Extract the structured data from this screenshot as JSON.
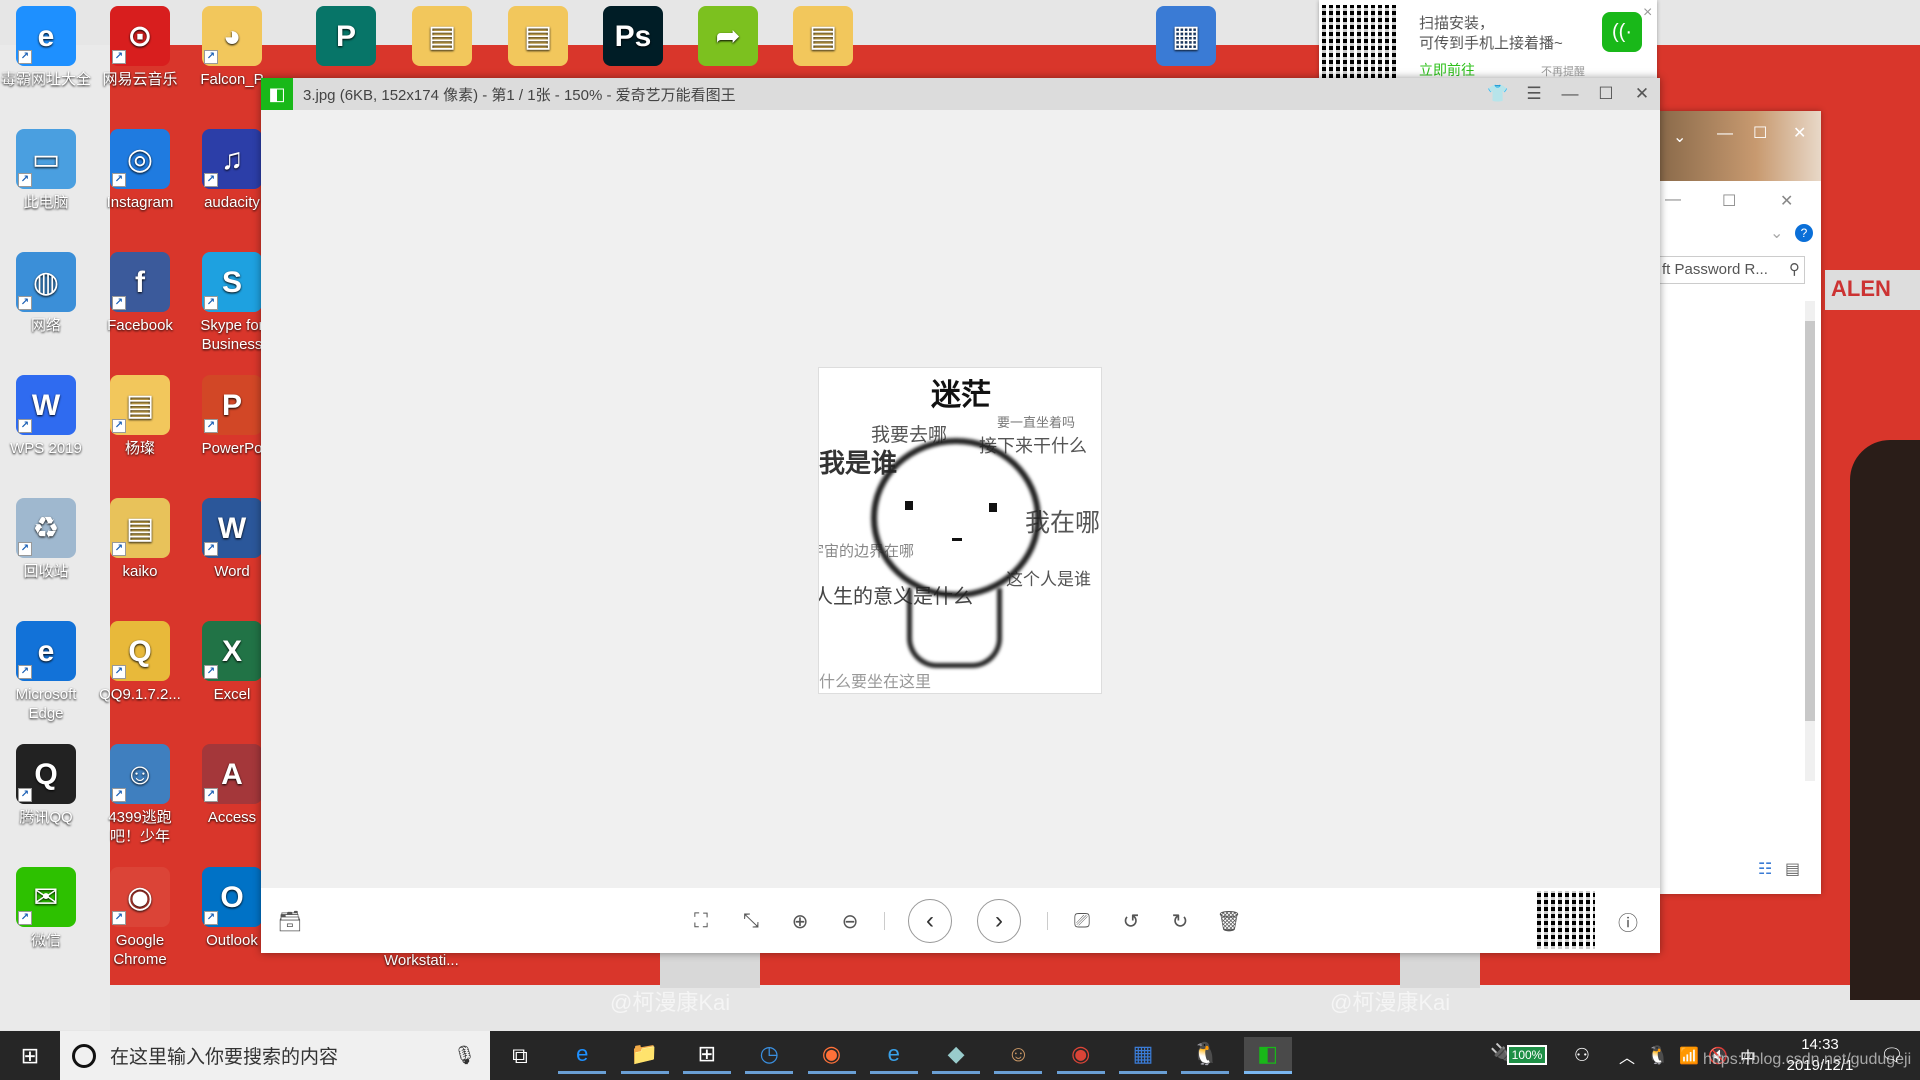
{
  "desktop": {
    "icons": [
      {
        "label": "毒霸网址大全",
        "glyph": "e",
        "color": "#1e90ff"
      },
      {
        "label": "网易云音乐",
        "glyph": "⊙",
        "color": "#d81e1e"
      },
      {
        "label": "Falcon_P",
        "glyph": "◕",
        "color": "#f2c75c"
      },
      {
        "label": "此电脑",
        "glyph": "▭",
        "color": "#4a9fe0"
      },
      {
        "label": "Instagram",
        "glyph": "◎",
        "color": "#1f7be0"
      },
      {
        "label": "audacity",
        "glyph": "♫",
        "color": "#2c3ea8"
      },
      {
        "label": "网络",
        "glyph": "◍",
        "color": "#3b8fd8"
      },
      {
        "label": "Facebook",
        "glyph": "f",
        "color": "#3b5a9b"
      },
      {
        "label": "Skype for Business",
        "glyph": "S",
        "color": "#1ea1e0"
      },
      {
        "label": "WPS 2019",
        "glyph": "W",
        "color": "#2f6bf0"
      },
      {
        "label": "杨璨",
        "glyph": "▤",
        "color": "#f2c75c"
      },
      {
        "label": "PowerPo",
        "glyph": "P",
        "color": "#d24726"
      },
      {
        "label": "回收站",
        "glyph": "♻",
        "color": "#9fb8cf"
      },
      {
        "label": "kaiko",
        "glyph": "▤",
        "color": "#e8c25a"
      },
      {
        "label": "Word",
        "glyph": "W",
        "color": "#2b579a"
      },
      {
        "label": "Microsoft Edge",
        "glyph": "e",
        "color": "#1272d8"
      },
      {
        "label": "QQ9.1.7.2...",
        "glyph": "Q",
        "color": "#e8b93a"
      },
      {
        "label": "Excel",
        "glyph": "X",
        "color": "#217346"
      },
      {
        "label": "腾讯QQ",
        "glyph": "Q",
        "color": "#222"
      },
      {
        "label": "4399逃跑吧！少年",
        "glyph": "☺",
        "color": "#3f7fbf"
      },
      {
        "label": "Access",
        "glyph": "A",
        "color": "#a4373a"
      },
      {
        "label": "微信",
        "glyph": "✉",
        "color": "#2dc100"
      },
      {
        "label": "Google Chrome",
        "glyph": "◉",
        "color": "#db4437"
      },
      {
        "label": "Outlook",
        "glyph": "O",
        "color": "#0072c6"
      }
    ],
    "top_icons": [
      {
        "glyph": "P",
        "color": "#077568"
      },
      {
        "glyph": "▤",
        "color": "#f2c75c"
      },
      {
        "glyph": "▤",
        "color": "#f2c75c"
      },
      {
        "glyph": "Ps",
        "color": "#001d26"
      },
      {
        "glyph": "➦",
        "color": "#7cc11f"
      },
      {
        "glyph": "▤",
        "color": "#f2c75c"
      },
      {
        "glyph": "▦",
        "color": "#3a7bd5"
      }
    ],
    "workstation_label": "Workstati...",
    "watermark": "@柯漫康Kai",
    "csdn_watermark": "https://blog.csdn.net/gudugeji"
  },
  "popup": {
    "line1": "扫描安装，",
    "line2": "可传到手机上接着播~",
    "go": "立即前往",
    "dismiss": "不再提醒",
    "close": "×"
  },
  "viewer": {
    "title": "3.jpg (6KB, 152x174 像素) - 第1 / 1张 - 150% - 爱奇艺万能看图王",
    "accent": "#19b819",
    "image_texts": [
      "迷茫",
      "我要去哪",
      "要一直坐着吗",
      "接下来干什么",
      "我是谁",
      "我在哪",
      "宇宙的边界在哪",
      "这个人是谁",
      "人生的意义是什么",
      "什么要坐在这里"
    ]
  },
  "back_window": {
    "search_text": "ft Password R..."
  },
  "taskbar": {
    "search_placeholder": "在这里输入你要搜索的内容",
    "battery": "100%",
    "ime": "中",
    "time": "14:33",
    "date": "2019/12/1"
  }
}
